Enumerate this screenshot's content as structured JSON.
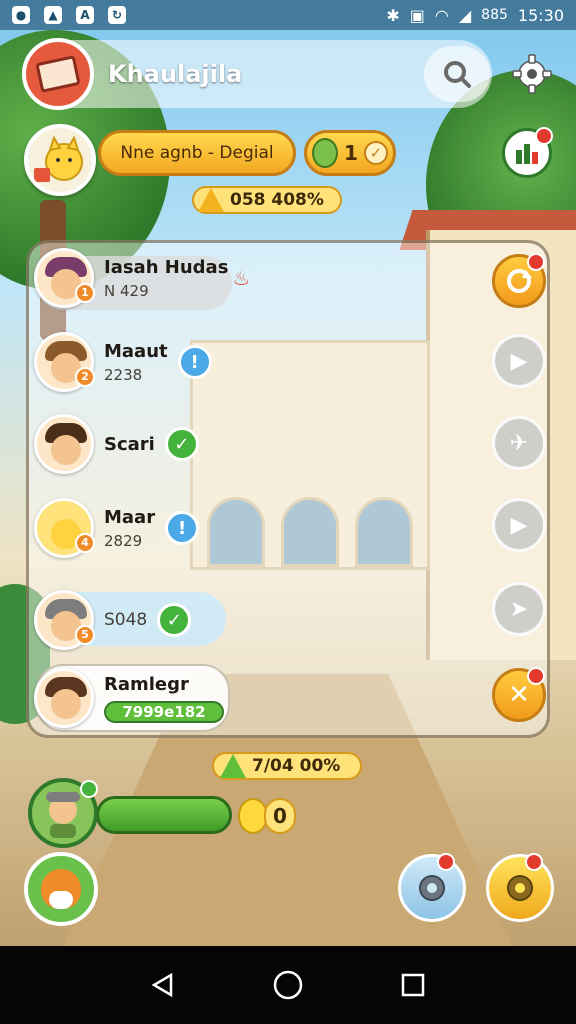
{
  "status_bar": {
    "time": "15:30",
    "battery": "885"
  },
  "header": {
    "title": "Khaulajila"
  },
  "player": {
    "name_label": "Nne agnb - Degial",
    "level": "1",
    "score": "058 408%"
  },
  "leaderboard": {
    "rows": [
      {
        "name": "Iasah Hudas",
        "score": "N 429"
      },
      {
        "name": "Maaut",
        "score": "2238"
      },
      {
        "name": "Scari",
        "score": ""
      },
      {
        "name": "Maar",
        "score": "2829"
      },
      {
        "name": "",
        "score": "S048"
      },
      {
        "name": "Ramlegr",
        "score": "7999e182"
      }
    ]
  },
  "bottom": {
    "score": "7/04 00%",
    "coins": "0"
  },
  "colors": {
    "accent_orange": "#f3a721",
    "accent_green": "#44b33c",
    "accent_blue": "#4aa9e6",
    "alert_red": "#e23b2d"
  }
}
